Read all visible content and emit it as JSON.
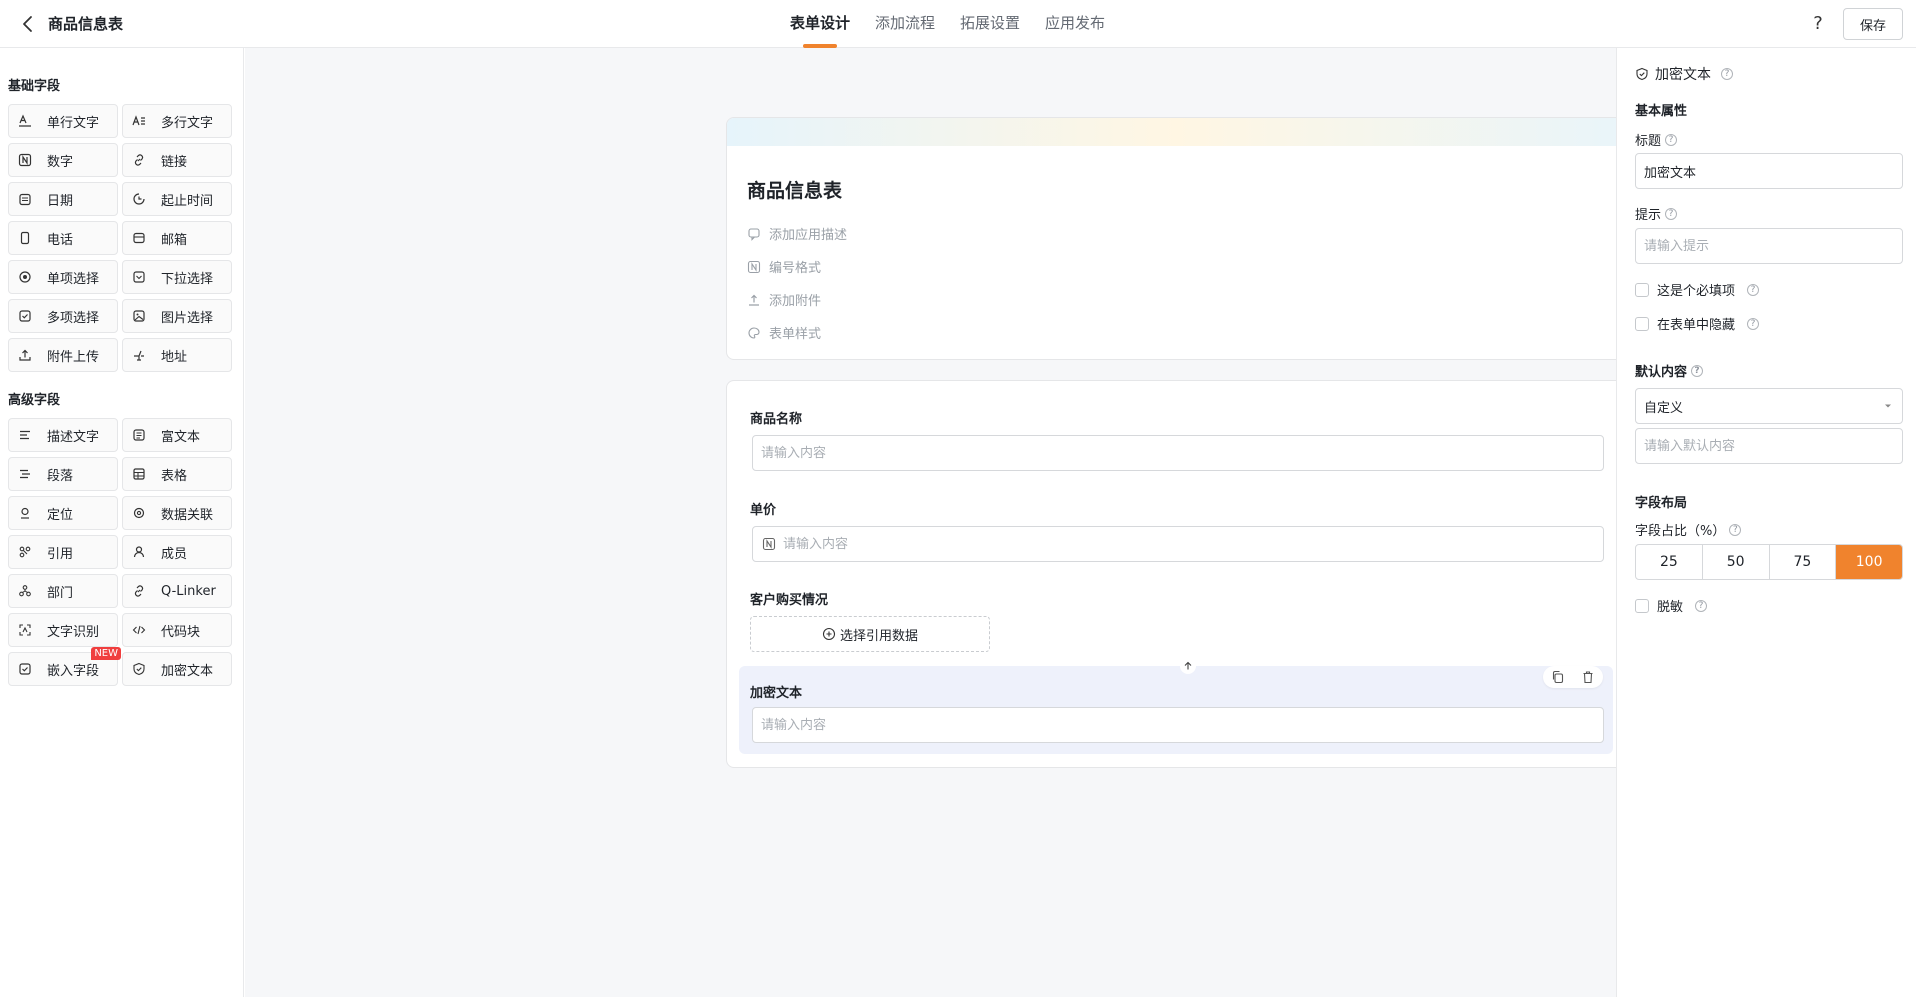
{
  "header": {
    "title": "商品信息表",
    "tabs": [
      "表单设计",
      "添加流程",
      "拓展设置",
      "应用发布"
    ],
    "help": "?",
    "save_label": "保存"
  },
  "left": {
    "basic_title": "基础字段",
    "basic_fields": [
      "单行文字",
      "多行文字",
      "数字",
      "链接",
      "日期",
      "起止时间",
      "电话",
      "邮箱",
      "单项选择",
      "下拉选择",
      "多项选择",
      "图片选择",
      "附件上传",
      "地址"
    ],
    "advanced_title": "高级字段",
    "advanced_fields": [
      "描述文字",
      "富文本",
      "段落",
      "表格",
      "定位",
      "数据关联",
      "引用",
      "成员",
      "部门",
      "Q-Linker",
      "文字识别",
      "代码块",
      "嵌入字段",
      "加密文本"
    ],
    "new_badge": "NEW"
  },
  "form": {
    "title": "商品信息表",
    "meta": [
      "添加应用描述",
      "编号格式",
      "添加附件",
      "表单样式"
    ],
    "fields": [
      {
        "label": "商品名称",
        "placeholder": "请输入内容"
      },
      {
        "label": "单价",
        "placeholder": "请输入内容"
      },
      {
        "label": "客户购买情况",
        "button": "选择引用数据"
      },
      {
        "label": "加密文本",
        "placeholder": "请输入内容"
      }
    ]
  },
  "props": {
    "field_name": "加密文本",
    "basic_section": "基本属性",
    "title_label": "标题",
    "title_value": "加密文本",
    "hint_label": "提示",
    "hint_placeholder": "请输入提示",
    "required_label": "这是个必填项",
    "hidden_label": "在表单中隐藏",
    "default_label": "默认内容",
    "default_select": "自定义",
    "default_placeholder": "请输入默认内容",
    "layout_section": "字段布局",
    "ratio_label": "字段占比（%）",
    "ratio_options": [
      "25",
      "50",
      "75",
      "100"
    ],
    "ratio_selected": "100",
    "mask_label": "脱敏"
  },
  "colors": {
    "accent": "#f0832d",
    "selected_bg": "#eef1fb",
    "badge": "#f03e3e"
  }
}
